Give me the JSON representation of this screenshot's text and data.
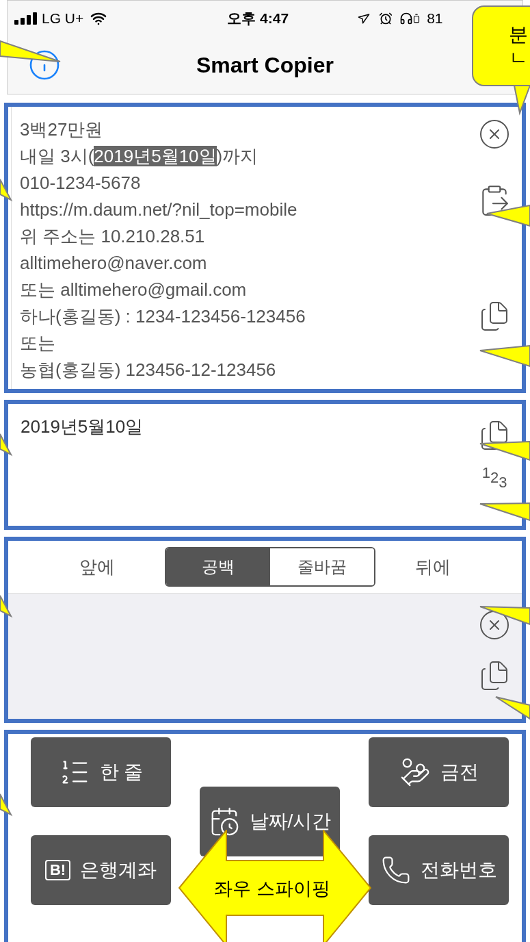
{
  "status_bar": {
    "carrier": "LG U+",
    "time": "오후 4:47",
    "battery": "81"
  },
  "nav": {
    "title": "Smart Copier"
  },
  "source_text": {
    "lines": [
      [
        {
          "text": "3백27만원",
          "selected": false
        }
      ],
      [
        {
          "text": "내일 3시(",
          "selected": false
        },
        {
          "text": "2019년5월10일",
          "selected": true
        },
        {
          "text": ")까지",
          "selected": false
        }
      ],
      [
        {
          "text": "010-1234-5678",
          "selected": false
        }
      ],
      [
        {
          "text": "https://m.daum.net/?nil_top=mobile",
          "selected": false
        }
      ],
      [
        {
          "text": "위 주소는 10.210.28.51",
          "selected": false
        }
      ],
      [
        {
          "text": "alltimehero@naver.com",
          "selected": false
        }
      ],
      [
        {
          "text": "또는 alltimehero@gmail.com",
          "selected": false
        }
      ],
      [
        {
          "text": "하나(홍길동) : 1234-123456-123456",
          "selected": false
        }
      ],
      [
        {
          "text": "또는",
          "selected": false
        }
      ],
      [
        {
          "text": "농협(홍길동) 123456-12-123456",
          "selected": false
        }
      ]
    ]
  },
  "result": {
    "text": "2019년5월10일",
    "number_icon": [
      "1",
      "2",
      "3"
    ]
  },
  "join": {
    "before": "앞에",
    "after": "뒤에",
    "options": [
      {
        "label": "공백",
        "selected": true
      },
      {
        "label": "줄바꿈",
        "selected": false
      }
    ]
  },
  "buttons": [
    {
      "label": "한 줄",
      "kind": "list"
    },
    {
      "label": "날짜/시간",
      "kind": "calendar"
    },
    {
      "label": "금전",
      "kind": "money"
    },
    {
      "label": "은행계좌",
      "kind": "bank",
      "icon_text": "B!"
    },
    {
      "label": "전화번호",
      "kind": "phone"
    }
  ],
  "annotations": {
    "swipe_arrow": "좌우 스파이핑",
    "callout": [
      "분",
      "ㄴ"
    ]
  }
}
